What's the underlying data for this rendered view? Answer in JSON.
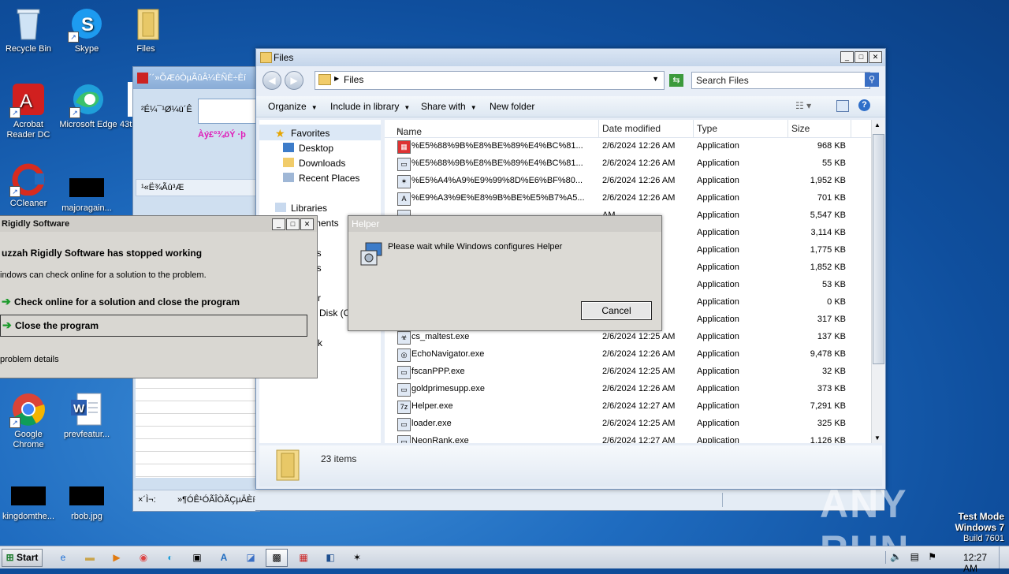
{
  "desktop": {
    "icons": [
      {
        "label": "Recycle Bin"
      },
      {
        "label": "Skype"
      },
      {
        "label": "Files"
      },
      {
        "label": "Acrobat Reader DC"
      },
      {
        "label": "Microsoft Edge"
      },
      {
        "label": "43t"
      },
      {
        "label": "CCleaner"
      },
      {
        "label": "majoragain..."
      },
      {
        "label": "Google Chrome"
      },
      {
        "label": "prevfeatur..."
      },
      {
        "label": "kingdomthe..."
      },
      {
        "label": "rbob.jpg"
      }
    ]
  },
  "bgapp": {
    "title": "´´»ÕÆóÒµÃûÂ¼ÈÑÈ÷Èí",
    "label1": "²É¼¯¹Ø¼ü´Ê",
    "link": "Àý£º¾öÝ ·þ",
    "list_header": "¹«Ë¾Ãû³Æ",
    "status_left": "×´Ì¬:",
    "status_right": "»¶Ó­Ê¹ÓÃÎÒÃÇµÄÈí¼þ"
  },
  "explorer": {
    "title": "Files",
    "breadcrumb": "Files",
    "search_placeholder": "Search Files",
    "commands": [
      "Organize",
      "Include in library",
      "Share with",
      "New folder"
    ],
    "nav": {
      "favorites": "Favorites",
      "desktop": "Desktop",
      "downloads": "Downloads",
      "recent": "Recent Places",
      "libraries": "Libraries",
      "documents_partial": "ments",
      "pictures_partial": "t",
      "music_partial": "res",
      "videos_partial": "os",
      "computer_partial": "ter",
      "disk_partial": "Disk (C:",
      "network_partial": "k"
    },
    "columns": [
      "Name",
      "Date modified",
      "Type",
      "Size"
    ],
    "files": [
      {
        "icon": "red-app-icon",
        "name": "%E5%88%9B%E8%BE%89%E4%BC%81...",
        "date": "2/6/2024 12:26 AM",
        "type": "Application",
        "size": "968 KB"
      },
      {
        "icon": "window-app-icon",
        "name": "%E5%88%9B%E8%BE%89%E4%BC%81...",
        "date": "2/6/2024 12:26 AM",
        "type": "Application",
        "size": "55 KB"
      },
      {
        "icon": "star-app-icon",
        "name": "%E5%A4%A9%E9%99%8D%E6%BF%80...",
        "date": "2/6/2024 12:26 AM",
        "type": "Application",
        "size": "1,952 KB"
      },
      {
        "icon": "a-app-icon",
        "name": "%E9%A3%9E%E8%9B%BE%E5%B7%A5...",
        "date": "2/6/2024 12:26 AM",
        "type": "Application",
        "size": "701 KB"
      },
      {
        "icon": "app-icon",
        "name": "",
        "date": "AM",
        "type": "Application",
        "size": "5,547 KB"
      },
      {
        "icon": "app-icon",
        "name": "",
        "date": "AM",
        "type": "Application",
        "size": "3,114 KB"
      },
      {
        "icon": "app-icon",
        "name": "",
        "date": "AM",
        "type": "Application",
        "size": "1,775 KB"
      },
      {
        "icon": "app-icon",
        "name": "",
        "date": "AM",
        "type": "Application",
        "size": "1,852 KB"
      },
      {
        "icon": "app-icon",
        "name": "",
        "date": "AM",
        "type": "Application",
        "size": "53 KB"
      },
      {
        "icon": "app-icon",
        "name": "",
        "date": "AM",
        "type": "Application",
        "size": "0 KB"
      },
      {
        "icon": "app-icon",
        "name": "",
        "date": "AM",
        "type": "Application",
        "size": "317 KB"
      },
      {
        "icon": "biohazard-icon",
        "name": "cs_maltest.exe",
        "date": "2/6/2024 12:25 AM",
        "type": "Application",
        "size": "137 KB"
      },
      {
        "icon": "echo-icon",
        "name": "EchoNavigator.exe",
        "date": "2/6/2024 12:26 AM",
        "type": "Application",
        "size": "9,478 KB"
      },
      {
        "icon": "window-app-icon",
        "name": "fscanPPP.exe",
        "date": "2/6/2024 12:25 AM",
        "type": "Application",
        "size": "32 KB"
      },
      {
        "icon": "window-app-icon",
        "name": "goldprimesupp.exe",
        "date": "2/6/2024 12:26 AM",
        "type": "Application",
        "size": "373 KB"
      },
      {
        "icon": "7z-icon",
        "name": "Helper.exe",
        "date": "2/6/2024 12:27 AM",
        "type": "Application",
        "size": "7,291 KB"
      },
      {
        "icon": "window-app-icon",
        "name": "loader.exe",
        "date": "2/6/2024 12:25 AM",
        "type": "Application",
        "size": "325 KB"
      },
      {
        "icon": "app-icon",
        "name": "NeonRank.exe",
        "date": "2/6/2024 12:27 AM",
        "type": "Application",
        "size": "1,126 KB"
      }
    ],
    "item_count": "23 items"
  },
  "helper": {
    "title": "Helper",
    "message": "Please wait while Windows configures Helper",
    "cancel": "Cancel"
  },
  "crash": {
    "title": "Rigidly Software",
    "heading": "uzzah Rigidly Software has stopped working",
    "sub": "indows can check online for a solution to the problem.",
    "option1": "Check online for a solution and close the program",
    "option2": "Close the program",
    "details": "problem details"
  },
  "taskbar": {
    "start": "Start",
    "clock": "12:27 AM"
  },
  "watermark": {
    "brand": "ANY RUN",
    "test_mode": "Test Mode",
    "os": "Windows 7",
    "build": "Build 7601"
  }
}
